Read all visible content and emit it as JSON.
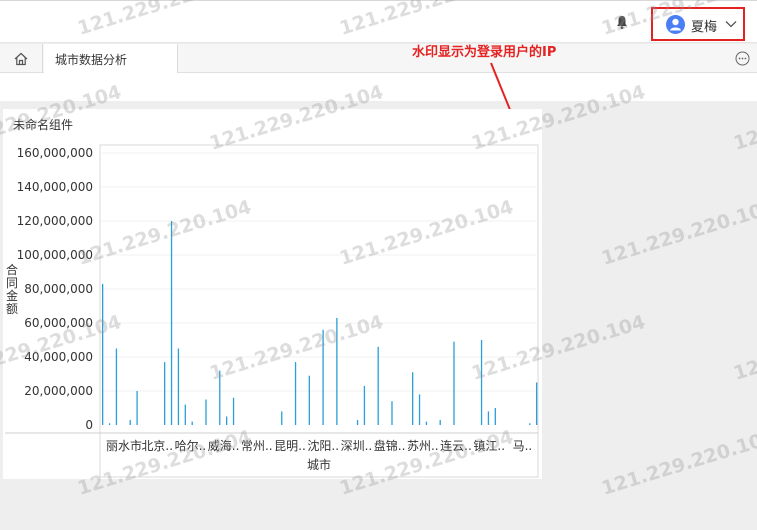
{
  "header": {
    "user_name": "夏梅",
    "bell_icon": "bell-icon",
    "user_icon": "user-avatar-icon",
    "dropdown_icon": "chevron-down-icon"
  },
  "tabs": {
    "home_icon": "home-icon",
    "active_label": "城市数据分析",
    "more_icon": "more-icon"
  },
  "annotation": "水印显示为登录用户的IP",
  "widget": {
    "title": "未命名组件"
  },
  "watermark": "121.229.220.104",
  "chart_data": {
    "type": "bar",
    "xlabel": "城市",
    "ylabel": "合同金额",
    "ylim": [
      0,
      160000000
    ],
    "y_ticks": [
      "0",
      "20,000,000",
      "40,000,000",
      "60,000,000",
      "80,000,000",
      "100,000,000",
      "120,000,000",
      "140,000,000",
      "160,000,000"
    ],
    "x_tick_labels": [
      "丽水市",
      "北京..",
      "哈尔..",
      "威海..",
      "常州..",
      "昆明..",
      "沈阳..",
      "深圳..",
      "盘锦..",
      "苏州..",
      "连云..",
      "镇江..",
      "马.."
    ],
    "values": [
      83000000,
      1000000,
      45000000,
      0,
      3000000,
      20000000,
      0,
      0,
      0,
      37000000,
      120000000,
      45000000,
      12000000,
      2000000,
      0,
      15000000,
      0,
      32000000,
      5000000,
      16000000,
      0,
      0,
      0,
      0,
      0,
      0,
      8000000,
      0,
      37000000,
      0,
      29000000,
      0,
      56000000,
      0,
      63000000,
      0,
      0,
      3000000,
      23000000,
      0,
      46000000,
      0,
      14000000,
      0,
      0,
      31000000,
      18000000,
      2000000,
      0,
      3000000,
      0,
      49000000,
      0,
      0,
      0,
      50000000,
      8000000,
      10000000,
      0,
      0,
      0,
      0,
      1000000,
      25000000
    ],
    "grid": true,
    "bar_color": "#2a9fd8"
  }
}
